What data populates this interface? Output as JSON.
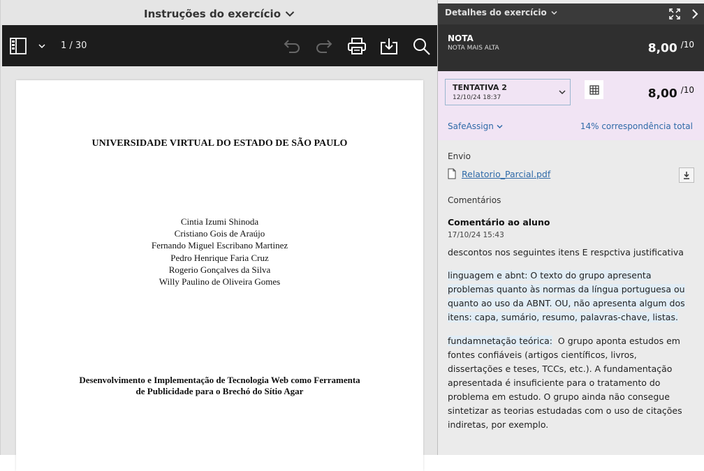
{
  "left_panel": {
    "header_title": "Instruções do exercício",
    "toolbar": {
      "page_indicator": "1 / 30"
    },
    "document": {
      "university": "UNIVERSIDADE VIRTUAL DO ESTADO DE SÃO PAULO",
      "authors": [
        "Cintia Izumi Shinoda",
        "Cristiano Gois de Araújo",
        "Fernando Miguel Escribano Martinez",
        "Pedro Henrique Faria Cruz",
        "Rogerio Gonçalves da Silva",
        "Willy Paulino de Oliveira Gomes"
      ],
      "title_lines": [
        "Desenvolvimento e Implementação de Tecnologia Web como Ferramenta",
        "de Publicidade para o Brechó do Sítio Agar"
      ]
    }
  },
  "right_panel": {
    "header_title": "Detalhes do exercício",
    "grade": {
      "label": "NOTA",
      "sublabel": "NOTA MAIS ALTA",
      "score": "8,00",
      "out_of": "/10"
    },
    "attempt": {
      "label": "TENTATIVA 2",
      "date": "12/10/24 18:37",
      "score": "8,00",
      "out_of": "/10"
    },
    "safeassign": {
      "label": "SafeAssign",
      "match": "14% correspondência total"
    },
    "submission": {
      "label": "Envio",
      "file_name": "Relatorio_Parcial.pdf"
    },
    "comments": {
      "label": "Comentários",
      "title": "Comentário ao aluno",
      "date": "17/10/24 15:43",
      "intro": "descontos nos seguintes itens E respctiva justificativa",
      "para1": "linguagem e abnt: O texto do grupo apresenta problemas quanto às normas da língua portuguesa ou quanto ao uso da ABNT. OU, não apresenta algum dos itens: capa, sumário, resumo, palavras-chave, listas.",
      "para2_label": "fundamnetação teórica:",
      "para2_text": "O grupo aponta estudos em fontes confiáveis (artigos científicos, livros, dissertações e teses, TCCs, etc.). A fundamentação apresentada é insuficiente para o tratamento do problema em estudo. O grupo ainda não consegue sintetizar as teorias estudadas com o uso de citações indiretas, por exemplo."
    }
  }
}
